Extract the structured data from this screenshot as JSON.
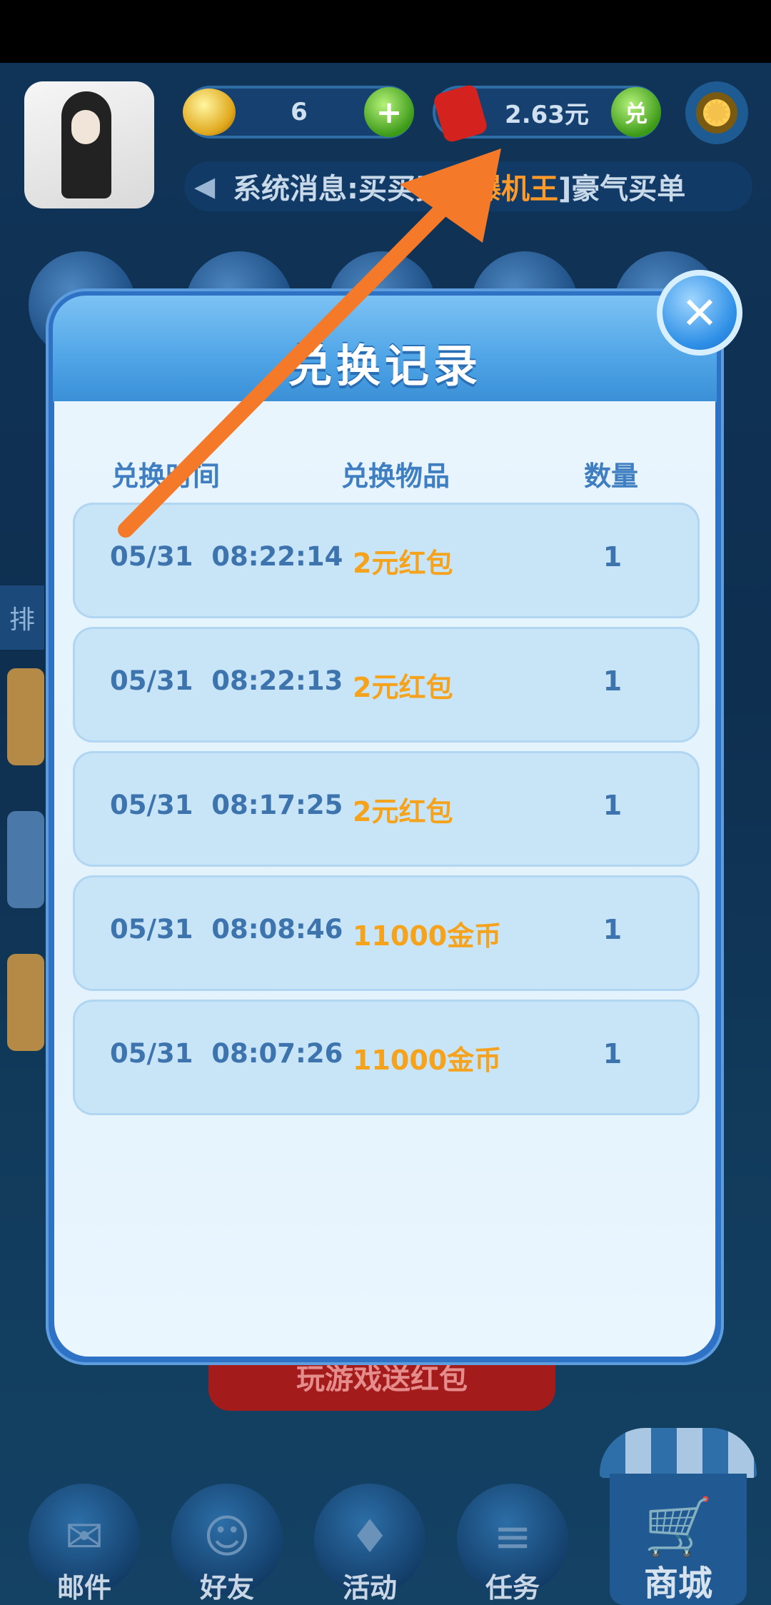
{
  "header": {
    "coin_count": "6",
    "plus_label": "+",
    "redpack_amount": "2.63元",
    "exchange_label": "兑",
    "gear_glyph": "✹",
    "system_message_prefix": "系统消息:买买买",
    "system_message_highlight": "打爆机王",
    "system_message_suffix": "]豪气买单"
  },
  "background": {
    "side_tab_label": "排",
    "play_button_label": "玩游戏送红包"
  },
  "dialog": {
    "title": "兑换记录",
    "close_glyph": "✕",
    "columns": [
      "兑换时间",
      "兑换物品",
      "数量"
    ],
    "records": [
      {
        "time": "05/31  08:22:14",
        "item": "2元红包",
        "qty": "1"
      },
      {
        "time": "05/31  08:22:13",
        "item": "2元红包",
        "qty": "1"
      },
      {
        "time": "05/31  08:17:25",
        "item": "2元红包",
        "qty": "1"
      },
      {
        "time": "05/31  08:08:46",
        "item": "11000金币",
        "qty": "1"
      },
      {
        "time": "05/31  08:07:26",
        "item": "11000金币",
        "qty": "1"
      }
    ]
  },
  "bottom_nav": {
    "items": [
      {
        "label": "邮件",
        "icon": "mail-icon",
        "glyph": "✉"
      },
      {
        "label": "好友",
        "icon": "friends-icon",
        "glyph": "☺"
      },
      {
        "label": "活动",
        "icon": "gift-icon",
        "glyph": "♦"
      },
      {
        "label": "任务",
        "icon": "task-icon",
        "glyph": "≡"
      }
    ],
    "shop": {
      "label": "商城",
      "icon": "cart-icon",
      "glyph": "🛒"
    }
  },
  "annotation": {
    "color": "#f47a2a"
  }
}
